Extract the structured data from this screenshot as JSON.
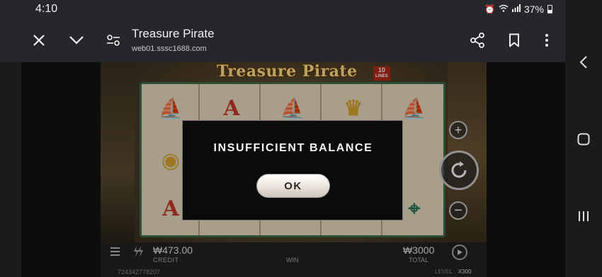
{
  "status_bar": {
    "time": "4:10",
    "battery": "37%"
  },
  "browser": {
    "page_title": "Treasure Pirate",
    "url": "web01.sssc1688.com"
  },
  "game": {
    "logo": "Treasure Pirate",
    "lines_badge": {
      "number": "10",
      "label": "LINES"
    },
    "reel_symbols": [
      [
        "ship",
        "",
        "",
        "",
        ""
      ],
      [
        "A",
        "",
        "",
        "",
        ""
      ],
      [
        "ship",
        "",
        "",
        "",
        ""
      ],
      [
        "gold",
        "",
        "",
        "",
        ""
      ],
      [
        "ship",
        "",
        "",
        "",
        ""
      ]
    ],
    "bottom_bar": {
      "credit_value": "₩473.00",
      "credit_label": "CREDIT",
      "win_label": "WIN",
      "total_value": "₩3000",
      "total_label": "TOTAL",
      "round_id": "724342778207",
      "level_label": "LEVEL",
      "level_value": "X300"
    }
  },
  "modal": {
    "message": "INSUFFICIENT BALANCE",
    "ok_label": "OK"
  },
  "colors": {
    "chrome": "#26272b",
    "modal_bg": "#0b0b0b",
    "reel_frame": "#3e6d48",
    "logo": "#ffe38a"
  }
}
